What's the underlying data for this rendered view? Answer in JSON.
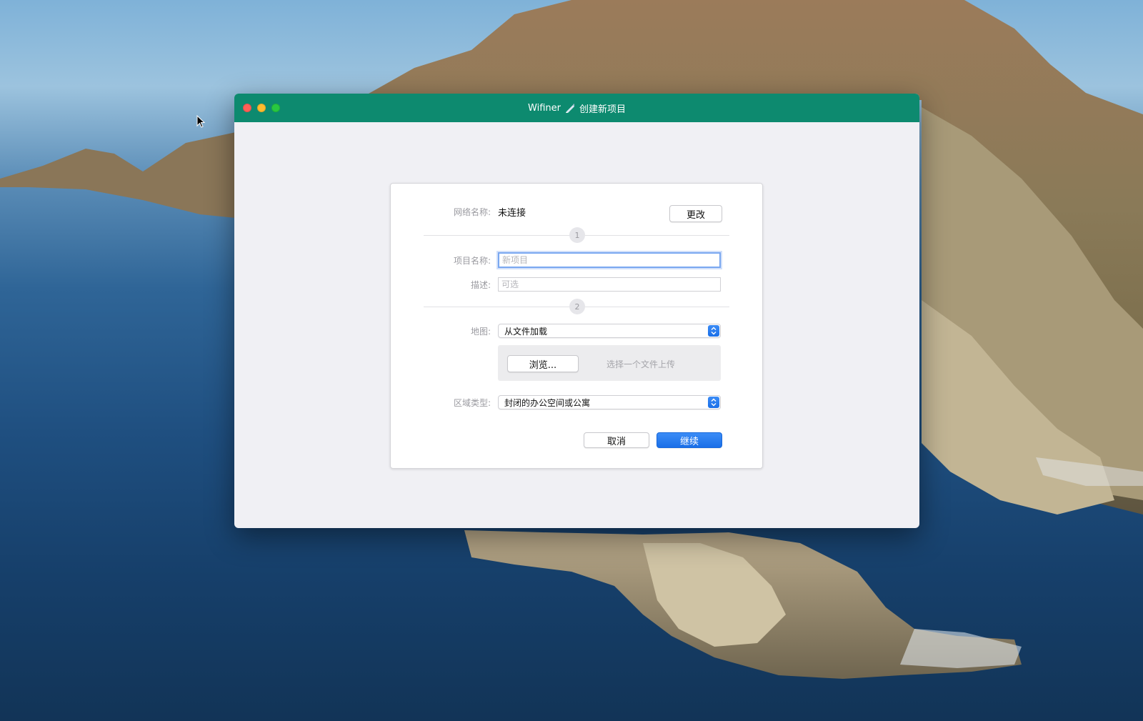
{
  "window": {
    "app_name": "Wifiner",
    "title": "创建新项目"
  },
  "network": {
    "label": "网络名称:",
    "value": "未连接",
    "change_button": "更改"
  },
  "steps": {
    "step1": "1",
    "step2": "2"
  },
  "project": {
    "name_label": "项目名称:",
    "name_placeholder": "新项目",
    "desc_label": "描述:",
    "desc_placeholder": "可选"
  },
  "map": {
    "label": "地图:",
    "selected": "从文件加载",
    "browse_button": "浏览...",
    "upload_hint": "选择一个文件上传"
  },
  "area": {
    "label": "区域类型:",
    "selected": "封闭的办公空间或公寓"
  },
  "actions": {
    "cancel": "取消",
    "continue": "继续"
  },
  "colors": {
    "titlebar": "#0d8a6f",
    "primary": "#1a6fe8"
  },
  "icons": {
    "title_icon": "wifiner-logo-icon",
    "select_arrow": "up-down-chevron-icon"
  }
}
